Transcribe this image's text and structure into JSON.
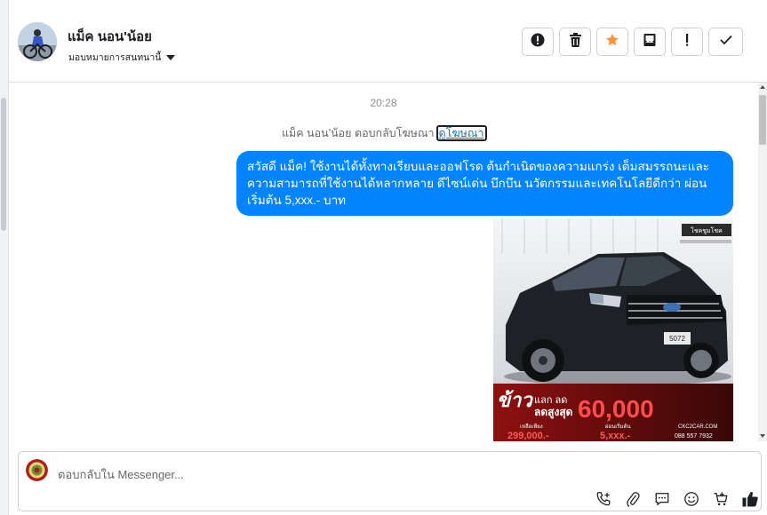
{
  "conversation": {
    "contact_name": "แม็ค นอน'น้อย",
    "assign_label": "มอบหมายการสนทนานี้"
  },
  "header_actions": [
    {
      "name": "spam-button",
      "icon": "alert-circle-icon"
    },
    {
      "name": "delete-button",
      "icon": "trash-icon"
    },
    {
      "name": "star-button",
      "icon": "star-icon",
      "color": "#f7923a"
    },
    {
      "name": "move-to-done-button",
      "icon": "inbox-icon"
    },
    {
      "name": "mark-important-button",
      "icon": "exclamation-icon"
    },
    {
      "name": "mark-done-button",
      "icon": "check-icon"
    }
  ],
  "chat": {
    "timestamp": "20:28",
    "reply_notice": "แม็ค นอน'น้อย ตอบกลับโฆษณา",
    "ad_link": "ดูโฆษณา",
    "message_text": "สวัสดี แม็ค! ใช้งานได้ทั้งทางเรียบและออฟโรด ต้นกำเนิดของความแกร่ง  เต็มสมรรถนะและความสามารถที่ใช้งานได้หลากหลาย ดีไซน์เด่น บึกบึน นวัตกรรมและเทคโนโลยีดีกว่า ผ่อนเริ่มต้น 5,xxx.- บาท",
    "bubble_color": "#0084ff"
  },
  "ad_image": {
    "brand": "โชคชูมโชค",
    "plate": "5072",
    "headline": "ข้าว",
    "sub1": "แลก ลด",
    "sub2": "ลดสูงสุด",
    "discount": "60,000",
    "price_label": "เหลือเพียง",
    "price": "299,000.-",
    "installment_label": "ผ่อนเริ่มต้น",
    "installment": "5,xxx.-",
    "site": "CKC2CAR.COM",
    "phone": "088 557 7932"
  },
  "composer": {
    "placeholder": "ตอบกลับใน Messenger..."
  },
  "composer_tools": [
    "add-call-icon",
    "paperclip-icon",
    "chat-bubble-icon",
    "smiley-icon",
    "cart-icon",
    "thumbs-up-icon"
  ]
}
